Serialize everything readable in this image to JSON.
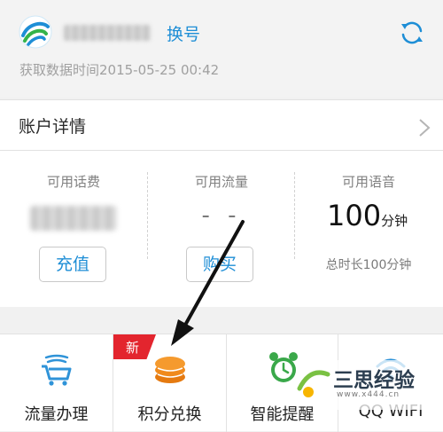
{
  "header": {
    "switch_label": "换号",
    "time_text": "获取数据时间2015-05-25  00:42"
  },
  "account": {
    "label": "账户详情"
  },
  "balance": {
    "fee": {
      "title": "可用话费",
      "button": "充值"
    },
    "data": {
      "title": "可用流量",
      "value": "- -",
      "button": "购买"
    },
    "voice": {
      "title": "可用语音",
      "value": "100",
      "unit": "分钟",
      "total": "总时长100分钟"
    }
  },
  "services": [
    {
      "label": "流量办理",
      "icon": "shopping-cart-icon"
    },
    {
      "label": "积分兑换",
      "icon": "coin-stack-icon",
      "badge": "新"
    },
    {
      "label": "智能提醒",
      "icon": "alarm-clock-icon"
    },
    {
      "label": "QQ WIFI",
      "icon": "wifi-icon"
    }
  ],
  "watermark": {
    "text": "三思经验",
    "url": "www.x444.cn"
  },
  "colors": {
    "accent": "#1e8ed6",
    "badge": "#e3252e",
    "coin": "#f08a1c"
  }
}
